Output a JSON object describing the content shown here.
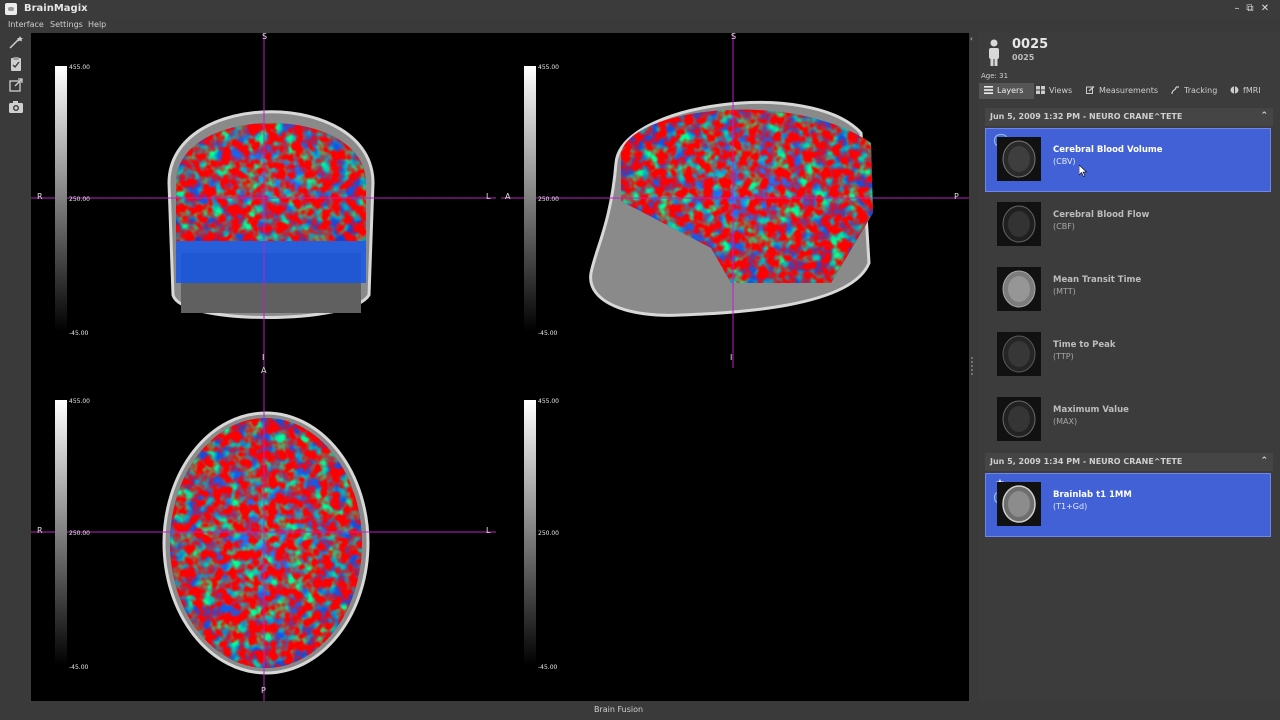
{
  "window": {
    "title": "BrainMagix",
    "minimize_label": "–",
    "restore_label": "⧉",
    "close_label": "✕"
  },
  "menu": [
    "Interface",
    "Settings",
    "Help"
  ],
  "toolbar": {
    "tools": [
      "magic-wand-icon",
      "clipboard-check-icon",
      "export-icon",
      "camera-icon"
    ]
  },
  "viewer": {
    "coronal": {
      "top": "S",
      "bottom": "I",
      "left": "R",
      "right": "L"
    },
    "sagittal": {
      "top": "S",
      "bottom": "I",
      "left": "A",
      "right": "P"
    },
    "axial": {
      "top": "A",
      "bottom": "P",
      "left": "R",
      "right": "L"
    },
    "colorbar": {
      "max": "455.00",
      "mid": "250.00",
      "min": "-45.00"
    }
  },
  "patient": {
    "name": "0025",
    "id": "0025",
    "age": "Age: 31"
  },
  "tabs": [
    {
      "label": "Layers",
      "active": true
    },
    {
      "label": "Views",
      "active": false
    },
    {
      "label": "Measurements",
      "active": false
    },
    {
      "label": "Tracking",
      "active": false
    },
    {
      "label": "fMRI",
      "active": false
    }
  ],
  "groups": [
    {
      "header": "Jun 5, 2009 1:32 PM - NEURO CRANE^TETE",
      "collapse": "⌃",
      "layers": [
        {
          "name": "Cerebral Blood Volume",
          "abbr": "(CBV)",
          "selected": true
        },
        {
          "name": "Cerebral Blood Flow",
          "abbr": "(CBF)",
          "selected": false
        },
        {
          "name": "Mean Transit Time",
          "abbr": "(MTT)",
          "selected": false
        },
        {
          "name": "Time to Peak",
          "abbr": "(TTP)",
          "selected": false
        },
        {
          "name": "Maximum Value",
          "abbr": "(MAX)",
          "selected": false
        }
      ]
    },
    {
      "header": "Jun 5, 2009 1:34 PM - NEURO CRANE^TETE",
      "collapse": "⌃",
      "layers": [
        {
          "name": "Brainlab t1 1MM",
          "abbr": "(T1+Gd)",
          "selected": true
        }
      ]
    }
  ],
  "status": "Brain Fusion",
  "colors": {
    "selection": "#4361d6",
    "crosshair": "#c020c8",
    "background": "#3a3a3a"
  }
}
